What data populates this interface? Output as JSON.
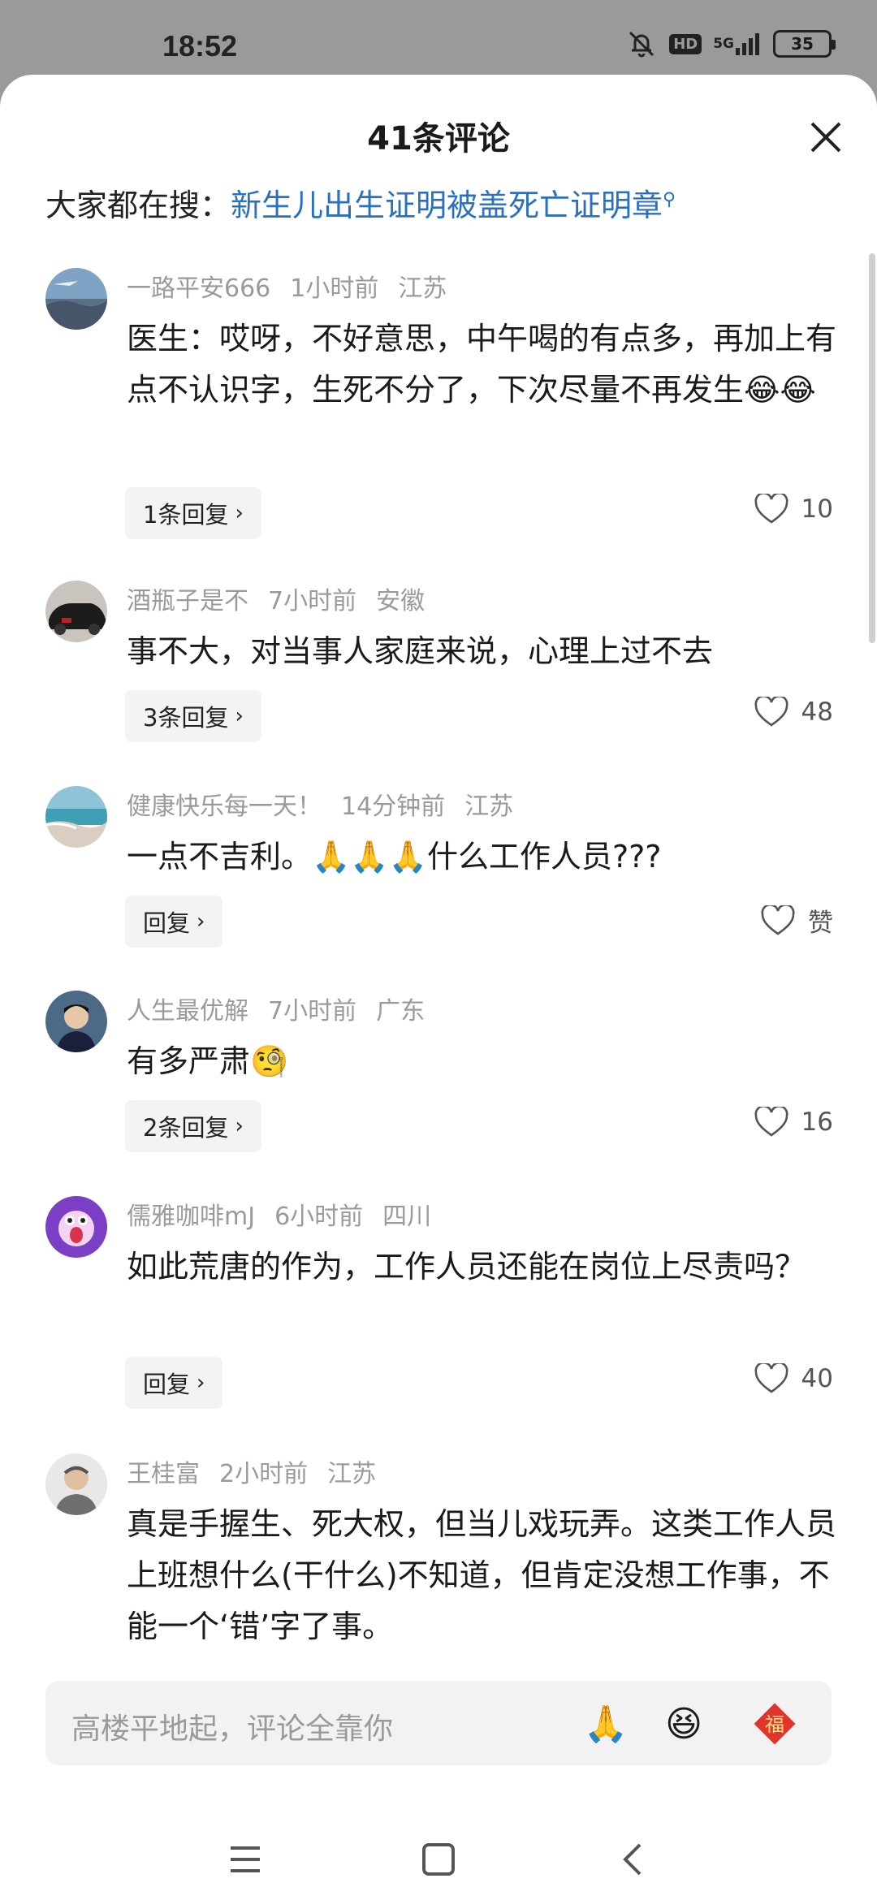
{
  "status_bar": {
    "time": "18:52",
    "hd": "HD",
    "network": "5G",
    "battery": "35"
  },
  "sheet": {
    "title": "41条评论",
    "search_lead": "大家都在搜：",
    "search_term": "新生儿出生证明被盖死亡证明章"
  },
  "comments": [
    {
      "user": "一路平安666",
      "time": "1小时前",
      "location": "江苏",
      "text": "医生：哎呀，不好意思，中午喝的有点多，再加上有点不认识字，生死不分了，下次尽量不再发生😂😂",
      "reply": "1条回复",
      "likes": "10"
    },
    {
      "user": "酒瓶子是不",
      "time": "7小时前",
      "location": "安徽",
      "text": "事不大，对当事人家庭来说，心理上过不去",
      "reply": "3条回复",
      "likes": "48"
    },
    {
      "user": "健康快乐每一天！",
      "time": "14分钟前",
      "location": "江苏",
      "text": "一点不吉利。🙏🙏🙏什么工作人员???",
      "reply": "回复",
      "likes": "赞"
    },
    {
      "user": "人生最优解",
      "time": "7小时前",
      "location": "广东",
      "text": "有多严肃🧐",
      "reply": "2条回复",
      "likes": "16"
    },
    {
      "user": "儒雅咖啡mJ",
      "time": "6小时前",
      "location": "四川",
      "text": "如此荒唐的作为，工作人员还能在岗位上尽责吗？",
      "reply": "回复",
      "likes": "40"
    },
    {
      "user": "王桂富",
      "time": "2小时前",
      "location": "江苏",
      "text": "真是手握生、死大权，但当儿戏玩弄。这类工作人员上班想什么(干什么)不知道，但肯定没想工作事，不能一个‘错’字了事。",
      "reply": "",
      "likes": ""
    }
  ],
  "input": {
    "placeholder": "高楼平地起，评论全靠你"
  },
  "icons": {
    "emoji_pray": "🙏",
    "emoji_laugh": "😆",
    "emoji_fu": "福"
  },
  "colors": {
    "link": "#2b6fbf",
    "meta": "#9a9a9a",
    "fu_red": "#e0342c"
  }
}
